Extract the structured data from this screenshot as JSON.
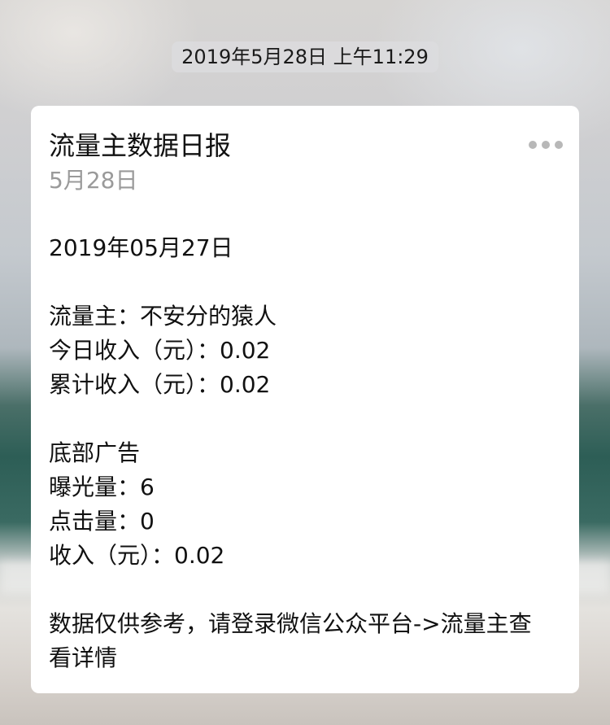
{
  "timestamp": "2019年5月28日 上午11:29",
  "message": {
    "title": "流量主数据日报",
    "date": "5月28日",
    "more_icon": "more-dots-icon",
    "report_date": "2019年05月27日",
    "publisher_line": "流量主：不安分的猿人",
    "today_income_line": "今日收入（元）：0.02",
    "total_income_line": "累计收入（元）：0.02",
    "ad_section_title": "底部广告",
    "impressions_line": "曝光量：6",
    "clicks_line": "点击量：0",
    "ad_income_line": "收入（元）：0.02",
    "footer_note": "数据仅供参考，请登录微信公众平台->流量主查看详情"
  }
}
